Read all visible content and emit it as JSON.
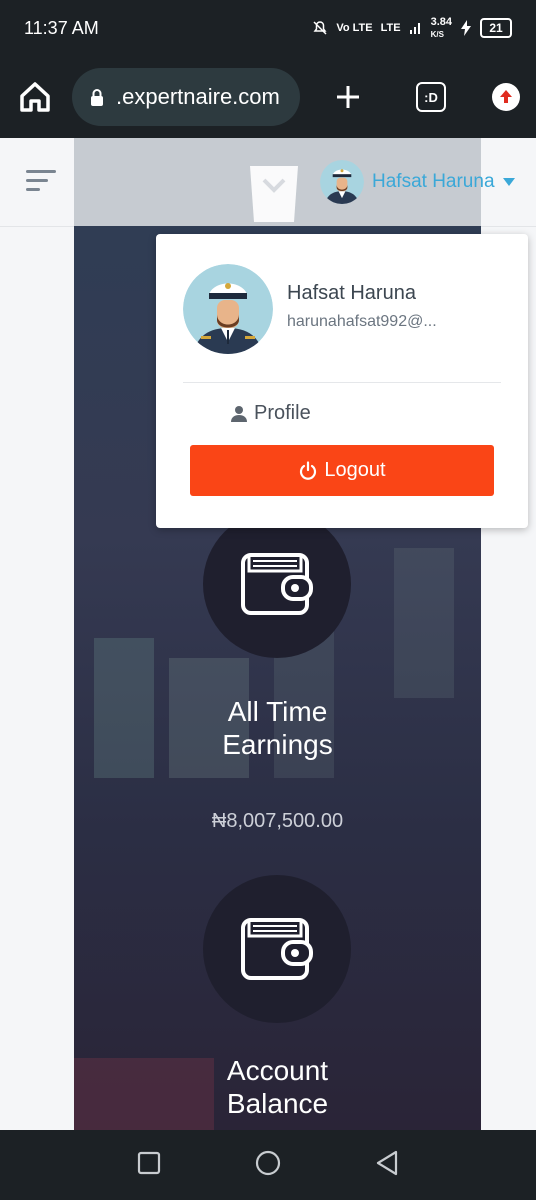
{
  "status_bar": {
    "time": "11:37 AM",
    "network": "Vo LTE",
    "network2": "LTE",
    "speed": "3.84",
    "speed_unit": "K/S",
    "battery": "21"
  },
  "browser": {
    "url": ".expertnaire.com",
    "tabs_label": ":D"
  },
  "header": {
    "user_name": "Hafsat Haruna"
  },
  "dropdown": {
    "name": "Hafsat Haruna",
    "email": "harunahafsat992@...",
    "profile_label": "Profile",
    "logout_label": "Logout"
  },
  "cards": [
    {
      "title_line1": "All Time",
      "title_line2": "Earnings",
      "amount": "₦8,007,500.00"
    },
    {
      "title_line1": "Account",
      "title_line2": "Balance"
    }
  ],
  "colors": {
    "accent": "#3aa8d8",
    "logout": "#fa4516",
    "dark_bar": "#1c2125"
  }
}
